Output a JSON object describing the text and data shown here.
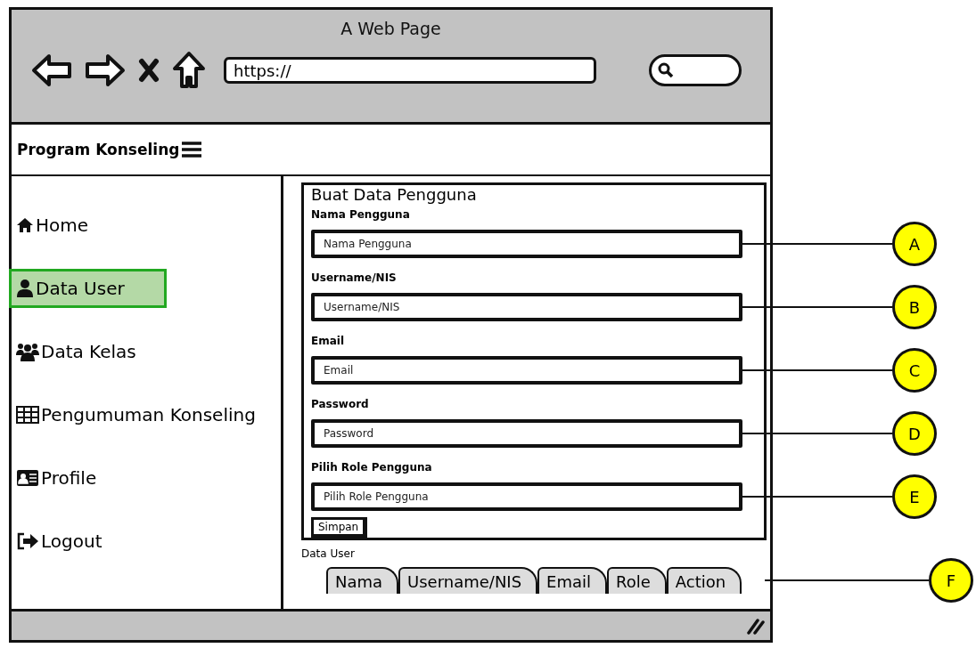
{
  "browser": {
    "title": "A Web Page",
    "url": "https://"
  },
  "header": {
    "app_name": "Program Konseling"
  },
  "sidebar": {
    "items": [
      {
        "label": "Home",
        "selected": false
      },
      {
        "label": "Data User",
        "selected": true
      },
      {
        "label": "Data Kelas",
        "selected": false
      },
      {
        "label": "Pengumuman Konseling",
        "selected": false
      },
      {
        "label": "Profile",
        "selected": false
      },
      {
        "label": "Logout",
        "selected": false
      }
    ]
  },
  "form": {
    "title": "Buat Data Pengguna",
    "fields": [
      {
        "label": "Nama Pengguna",
        "placeholder": "Nama Pengguna",
        "marker": "A"
      },
      {
        "label": "Username/NIS",
        "placeholder": "Username/NIS",
        "marker": "B"
      },
      {
        "label": "Email",
        "placeholder": "Email",
        "marker": "C"
      },
      {
        "label": "Password",
        "placeholder": "Password",
        "marker": "D"
      },
      {
        "label": "Pilih Role Pengguna",
        "placeholder": "Pilih Role Pengguna",
        "marker": "E"
      }
    ],
    "button": "Simpan"
  },
  "table": {
    "caption": "Data User",
    "columns": [
      "Nama",
      "Username/NIS",
      "Email",
      "Role",
      "Action"
    ],
    "marker": "F"
  }
}
